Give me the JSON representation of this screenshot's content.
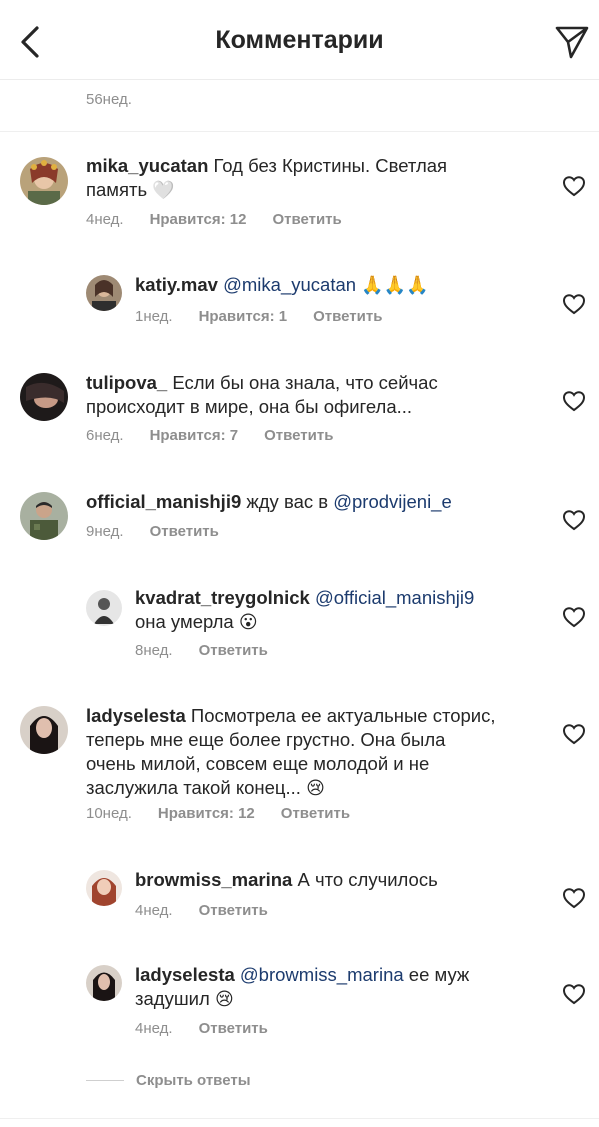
{
  "header": {
    "title": "Комментарии"
  },
  "previous": {
    "time": "56нед."
  },
  "comments": [
    {
      "username": "mika_yucatan",
      "mention": "",
      "text": "Год без Кристины. Светлая",
      "text2": "память",
      "emoji": "🤍",
      "time": "4нед.",
      "likes": "Нравится: 12",
      "reply": "Ответить"
    },
    {
      "username": "katiy.mav",
      "mention": "@mika_yucatan",
      "text": "",
      "emoji": "🙏🙏🙏",
      "time": "1нед.",
      "likes": "Нравится: 1",
      "reply": "Ответить"
    },
    {
      "username": "tulipova_",
      "mention": "",
      "text": "Если бы она знала, что сейчас",
      "text2": "происходит в мире, она бы офигела...",
      "time": "6нед.",
      "likes": "Нравится: 7",
      "reply": "Ответить"
    },
    {
      "username": "official_manishji9",
      "mention": "@prodvijeni_e",
      "text": "жду вас в",
      "time": "9нед.",
      "reply": "Ответить"
    },
    {
      "username": "kvadrat_treygolnick",
      "mention": "@official_manishji9",
      "text2": "она умерла",
      "emoji": "😮",
      "time": "8нед.",
      "reply": "Ответить"
    },
    {
      "username": "ladyselesta",
      "text": "Посмотрела ее актуальные сторис,",
      "text2": "теперь мне еще более грустно. Она была",
      "text3": "очень милой, совсем еще молодой и не",
      "text4": "заслужила такой конец...",
      "emoji": "😢",
      "time": "10нед.",
      "likes": "Нравится: 12",
      "reply": "Ответить"
    },
    {
      "username": "browmiss_marina",
      "text": "А что случилось",
      "time": "4нед.",
      "reply": "Ответить"
    },
    {
      "username": "ladyselesta",
      "mention": "@browmiss_marina",
      "text": "ее муж",
      "text2": "задушил",
      "emoji": "😢",
      "time": "4нед.",
      "reply": "Ответить"
    }
  ],
  "hide_replies": "Скрыть ответы",
  "icons": {
    "back": "chevron-left-icon",
    "send": "paper-plane-icon",
    "like": "heart-outline-icon"
  }
}
